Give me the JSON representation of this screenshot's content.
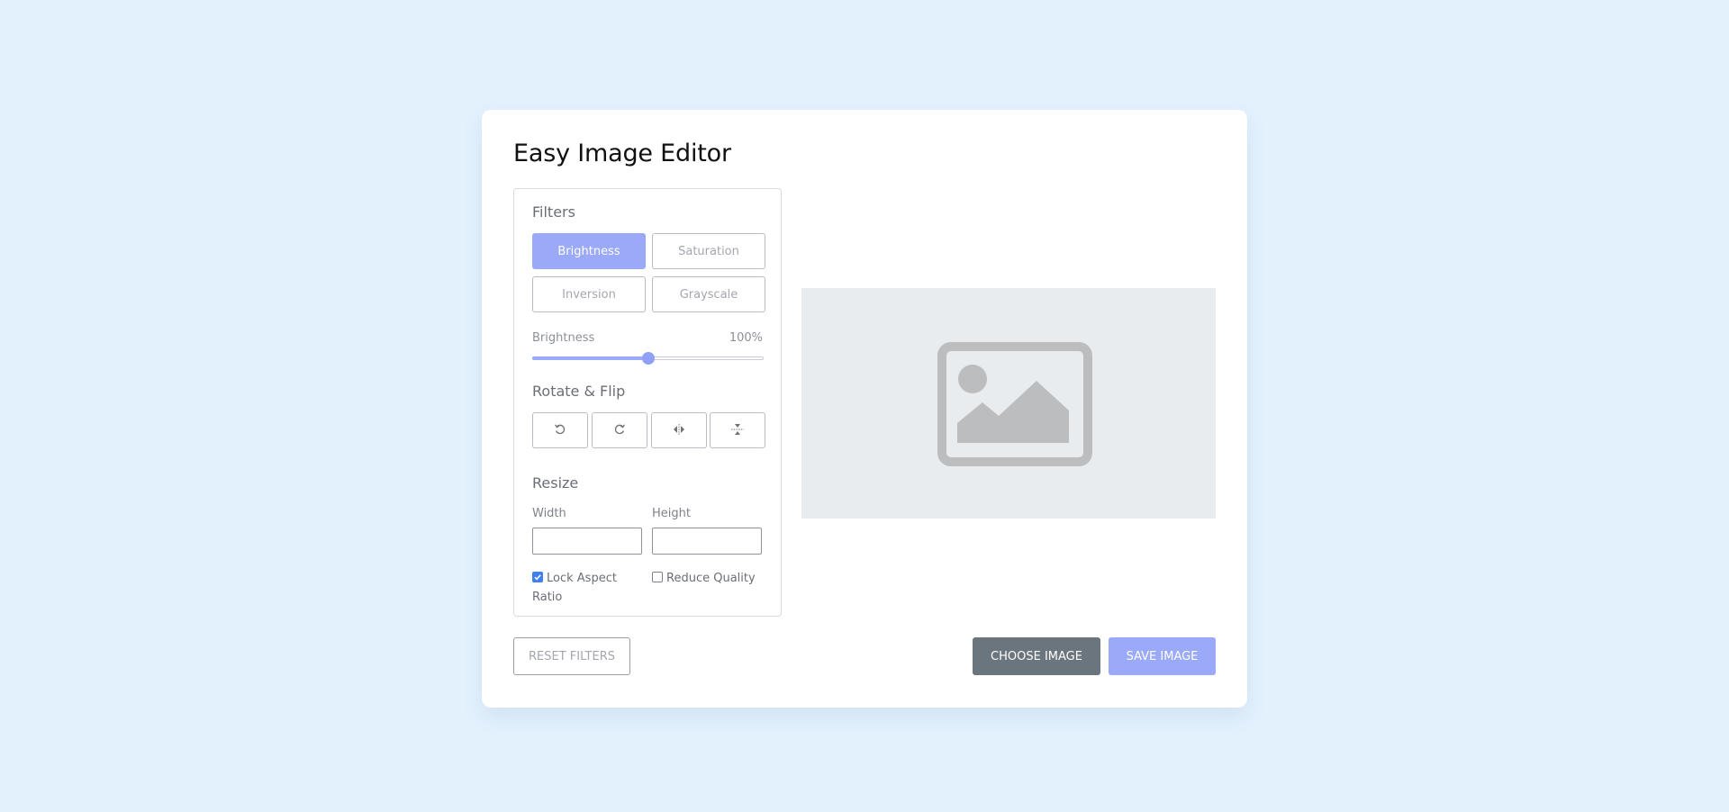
{
  "app": {
    "title": "Easy Image Editor"
  },
  "filters": {
    "title": "Filters",
    "buttons": [
      "Brightness",
      "Saturation",
      "Inversion",
      "Grayscale"
    ],
    "active": "Brightness",
    "slider": {
      "label": "Brightness",
      "value_text": "100%",
      "value": 100,
      "max": 200
    }
  },
  "rotate": {
    "title": "Rotate & Flip",
    "buttons": [
      "rotate-left-icon",
      "rotate-right-icon",
      "flip-horizontal-icon",
      "flip-vertical-icon"
    ]
  },
  "resize": {
    "title": "Resize",
    "width_label": "Width",
    "height_label": "Height",
    "width_value": "",
    "height_value": "",
    "lock_label": "Lock Aspect Ratio",
    "lock_checked": true,
    "quality_label": "Reduce Quality",
    "quality_checked": false
  },
  "preview": {
    "icon": "image-placeholder-icon"
  },
  "actions": {
    "reset": "RESET FILTERS",
    "choose": "CHOOSE IMAGE",
    "save": "SAVE IMAGE"
  },
  "colors": {
    "accent": "#9aaaf8",
    "choose_button": "#6b757d",
    "background": "#e3f1fd"
  }
}
